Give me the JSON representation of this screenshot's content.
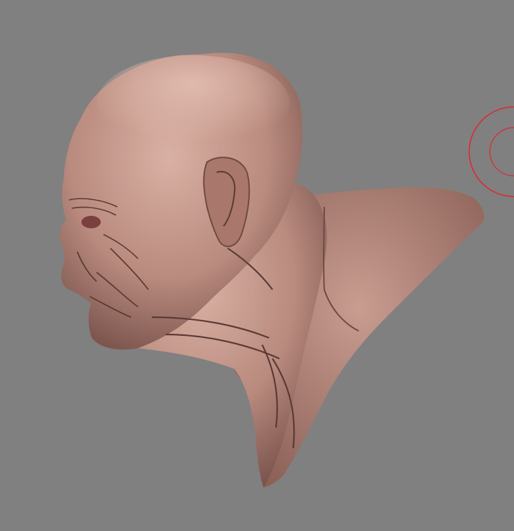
{
  "canvas": {
    "background_color": "#808080"
  },
  "model": {
    "subject": "sculpted-bald-head-bust-profile",
    "skin_base_color": "#b98a7e",
    "skin_highlight_color": "#d9b1a4",
    "skin_shadow_color": "#6e4a43",
    "wrinkle_color": "#5a3a34"
  },
  "brush_cursor": {
    "icon": "brush-draw-size-circle-icon",
    "color": "#e0252c"
  }
}
